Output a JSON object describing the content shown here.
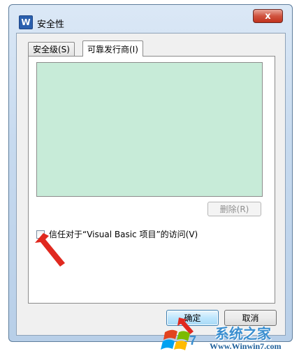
{
  "window": {
    "app_icon_letter": "W",
    "title": "安全性",
    "close_glyph": "x"
  },
  "tabs": [
    {
      "label": "安全级(S)",
      "active": false
    },
    {
      "label": "可靠发行商(I)",
      "active": true
    }
  ],
  "publishers": {
    "list_items": [],
    "remove_button_label": "删除(R)",
    "remove_enabled": false
  },
  "trust_vba": {
    "label": "信任对于“Visual Basic 项目”的访问(V)",
    "checked": false
  },
  "buttons": {
    "ok_label": "确定",
    "cancel_label": "取消"
  },
  "watermark": {
    "brand": "系统之家",
    "url": "Www.Winwin7.com"
  },
  "colors": {
    "list_background": "#c7ebd8",
    "annotation_arrow": "#e0291f",
    "close_button": "#c9402b"
  }
}
